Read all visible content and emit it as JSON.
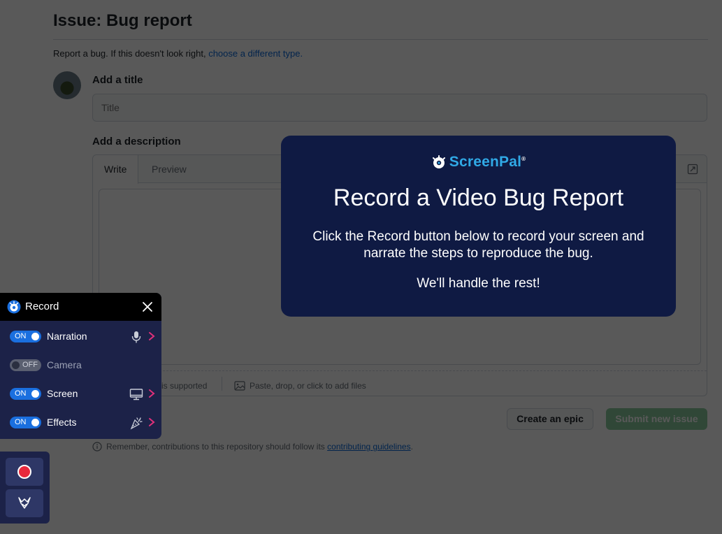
{
  "issue": {
    "heading": "Issue: Bug report",
    "subtext": "Report a bug. If this doesn't look right,",
    "subtext_link": "choose a different type.",
    "title_label": "Add a title",
    "title_placeholder": "Title",
    "description_label": "Add a description",
    "tabs": [
      "Write",
      "Preview"
    ],
    "markdown_note": "is supported",
    "attach_text": "Paste, drop, or click to add files",
    "create_epic_label": "Create an epic",
    "submit_label": "Submit new issue",
    "info_text": "Remember, contributions to this repository should follow its",
    "info_link": "contributing guidelines",
    "info_end": "."
  },
  "modal": {
    "brand": "ScreenPal",
    "brand_mark": "®",
    "title": "Record a Video Bug Report",
    "body": "Click the Record button below to record your screen and narrate the steps to reproduce the bug.",
    "rest": "We'll handle the rest!",
    "background_color": "#0f1a43",
    "brand_color": "#30a9e6"
  },
  "record_panel": {
    "title": "Record",
    "rows": [
      {
        "label": "Narration",
        "state": "ON",
        "icon": "microphone-icon"
      },
      {
        "label": "Camera",
        "state": "OFF",
        "icon": ""
      },
      {
        "label": "Screen",
        "state": "ON",
        "icon": "monitor-icon"
      },
      {
        "label": "Effects",
        "state": "ON",
        "icon": "effects-icon"
      }
    ],
    "toggle_on_color": "#1a6fdf",
    "chevron_color": "#e0307a",
    "record_color": "#e8283c"
  }
}
